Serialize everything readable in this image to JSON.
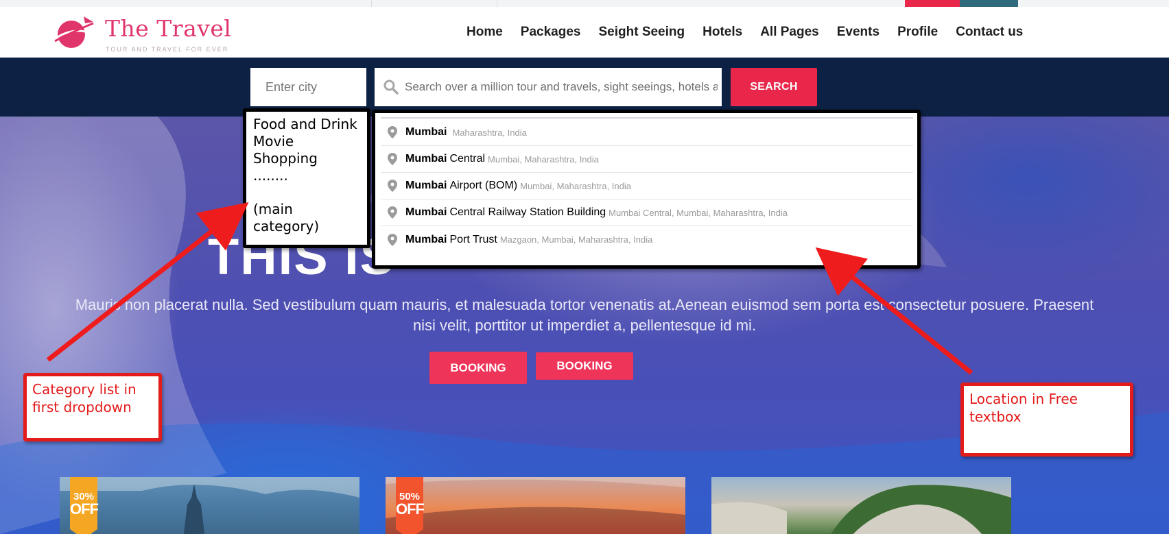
{
  "header": {
    "logo_title": "The Travel",
    "logo_tagline": "TOUR AND TRAVEL FOR EVER",
    "nav": [
      "Home",
      "Packages",
      "Seight Seeing",
      "Hotels",
      "All Pages",
      "Events",
      "Profile",
      "Contact us"
    ]
  },
  "search": {
    "city_placeholder": "Enter city",
    "query_placeholder": "Search over a million tour and travels, sight seeings, hotels and more",
    "button_label": "SEARCH"
  },
  "category_dropdown": {
    "items": [
      "Food and Drink",
      "Movie",
      "Shopping"
    ],
    "ellipsis": "........",
    "note_line1": "(main",
    "note_line2": "category)"
  },
  "location_suggestions": [
    {
      "bold": "Mumbai",
      "rest": "",
      "sub": "Maharashtra, India"
    },
    {
      "bold": "Mumbai",
      "rest": "Central",
      "sub": "Mumbai, Maharashtra, India"
    },
    {
      "bold": "Mumbai",
      "rest": "Airport (BOM)",
      "sub": "Mumbai, Maharashtra, India"
    },
    {
      "bold": "Mumbai",
      "rest": "Central Railway Station Building",
      "sub": "Mumbai Central, Mumbai, Maharashtra, India"
    },
    {
      "bold": "Mumbai",
      "rest": "Port Trust",
      "sub": "Mazgaon, Mumbai, Maharashtra, India"
    }
  ],
  "hero": {
    "title": "THIS IS",
    "text": "Mauris non placerat nulla. Sed vestibulum quam mauris, et malesuada tortor venenatis at.Aenean euismod sem porta est consectetur posuere. Praesent nisi velit, porttitor ut imperdiet a, pellentesque id mi.",
    "booking_primary": "BOOKING",
    "booking_secondary": "BOOKING"
  },
  "cards": [
    {
      "discount": "30%",
      "off": "OFF",
      "ribbon_color": "#f5a623"
    },
    {
      "discount": "50%",
      "off": "OFF",
      "ribbon_color": "#f2542d"
    },
    {
      "discount": "",
      "off": "",
      "ribbon_color": ""
    }
  ],
  "annotations": {
    "left_line1": "Category list in",
    "left_line2": "first dropdown",
    "right_line1": "Location in Free",
    "right_line2": "textbox"
  },
  "colors": {
    "accent_red": "#e8274b",
    "band_navy": "#0d2144",
    "annotation_red": "#e31b1b"
  }
}
